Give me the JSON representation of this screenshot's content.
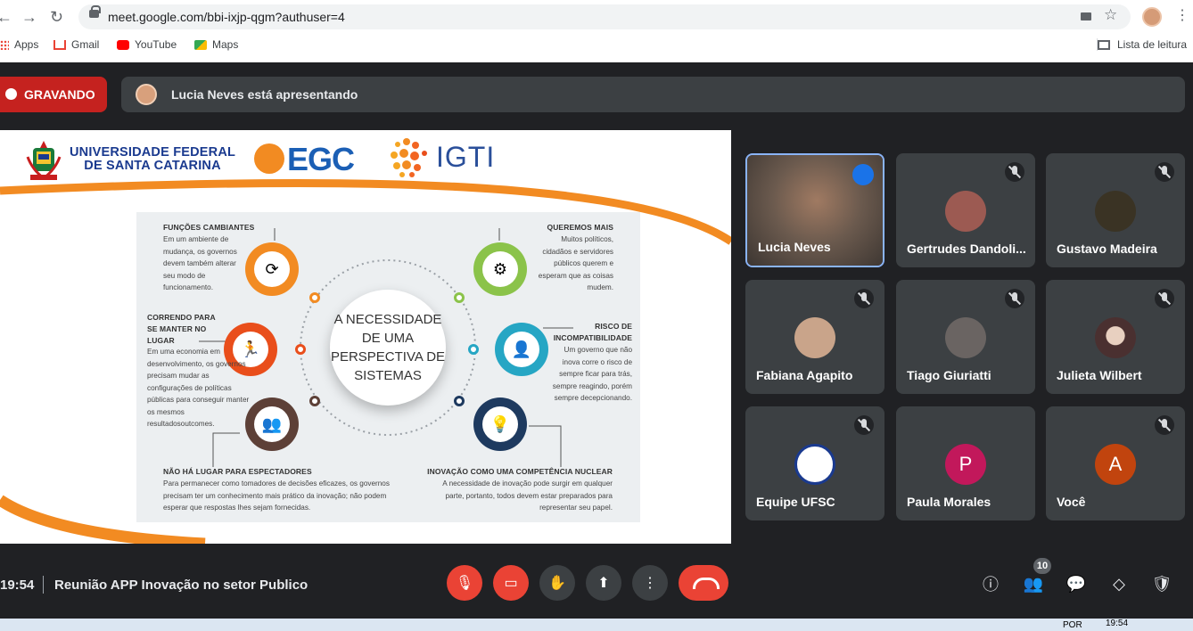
{
  "browser": {
    "url": "meet.google.com/bbi-ixjp-qgm?authuser=4",
    "bookmarks": [
      "Apps",
      "Gmail",
      "YouTube",
      "Maps"
    ],
    "reading_list": "Lista de leitura"
  },
  "banner": {
    "recording": "GRAVANDO",
    "presenting": "Lucia Neves está apresentando"
  },
  "slide": {
    "university": [
      "UNIVERSIDADE FEDERAL",
      "DE SANTA CATARINA"
    ],
    "egc": "EGC",
    "igti": "IGTI",
    "center": "A NECESSIDADE DE UMA PERSPECTIVA DE SISTEMAS",
    "items": [
      {
        "title": "FUNÇÕES CAMBIANTES",
        "body": "Em um ambiente de mudança, os governos devem também alterar seu modo de funcionamento."
      },
      {
        "title": "CORRENDO PARA SE MANTER NO LUGAR",
        "body": "Em uma economia em desenvolvimento, os governos precisam mudar as configurações de políticas públicas para conseguir manter os mesmos resultadosoutcomes."
      },
      {
        "title": "NÃO HÁ LUGAR PARA ESPECTADORES",
        "body": "Para permanecer como tomadores de decisões eficazes, os governos precisam ter um conhecimento mais prático da inovação; não podem esperar que respostas lhes sejam fornecidas."
      },
      {
        "title": "QUEREMOS MAIS",
        "body": "Muitos políticos, cidadãos e servidores públicos querem e esperam que as coisas mudem."
      },
      {
        "title": "RISCO DE INCOMPATIBILIDADE",
        "body": "Um governo que não inova corre o risco de sempre ficar para trás, sempre reagindo, porém sempre decepcionando."
      },
      {
        "title": "INOVAÇÃO COMO UMA COMPETÊNCIA NUCLEAR",
        "body": "A necessidade de inovação pode surgir em qualquer parte, portanto, todos devem estar preparados para representar seu papel."
      }
    ]
  },
  "participants": [
    {
      "name": "Lucia Neves",
      "speaking": true,
      "color": "#6b5a4e"
    },
    {
      "name": "Gertrudes Dandoli...",
      "color": "#9c5a52"
    },
    {
      "name": "Gustavo Madeira",
      "color": "#3a3324"
    },
    {
      "name": "Fabiana Agapito",
      "color": "#c9a48a"
    },
    {
      "name": "Tiago Giuriatti",
      "color": "#6a6462"
    },
    {
      "name": "Julieta Wilbert",
      "color": "#4a3030"
    },
    {
      "name": "Equipe UFSC",
      "color": "#ffffff"
    },
    {
      "name": "Paula Morales",
      "letter": "P",
      "color": "#c2185b"
    },
    {
      "name": "Você",
      "letter": "A",
      "color": "#c1440e"
    }
  ],
  "footer": {
    "time": "19:54",
    "title": "Reunião APP Inovação no setor Publico",
    "people_count": "10"
  },
  "taskbar": {
    "lang": "POR",
    "time": "19:54"
  }
}
